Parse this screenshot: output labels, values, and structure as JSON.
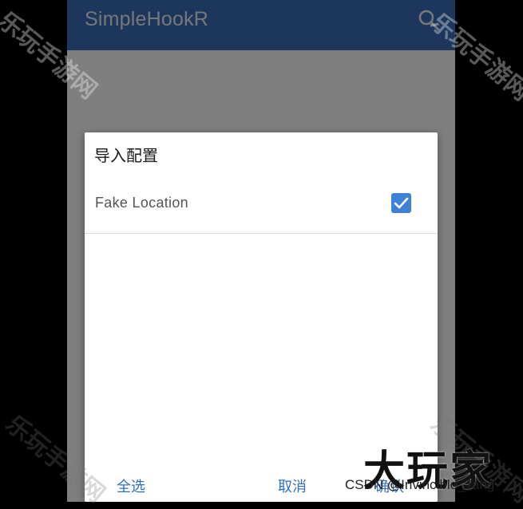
{
  "app": {
    "title": "SimpleHookR",
    "search_icon": "search-icon"
  },
  "dialog": {
    "title": "导入配置",
    "items": [
      {
        "label": "Fake Location",
        "checked": true
      }
    ],
    "buttons": {
      "select_all": "全选",
      "cancel": "取消",
      "confirm": "确认"
    }
  },
  "watermarks": {
    "site": "乐玩手游网",
    "brand": "大玩家",
    "credit": "CSDN @Invincible_Tang"
  },
  "colors": {
    "appbar": "#3a6fb9",
    "accent": "#2f6fc0",
    "checkbox": "#3d82d6"
  }
}
